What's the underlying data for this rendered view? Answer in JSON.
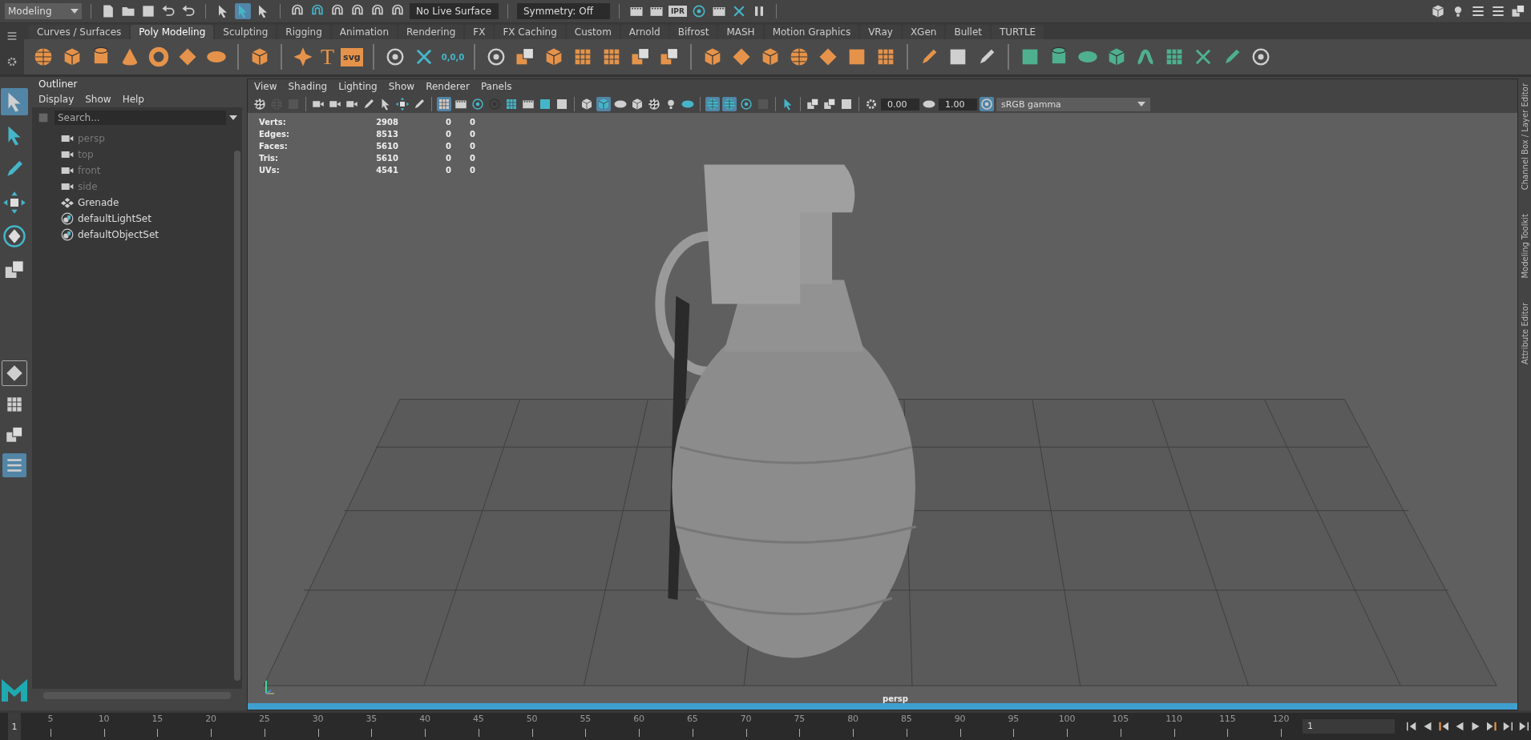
{
  "top_bar": {
    "menu_set": "Modeling",
    "live_surface": "No Live Surface",
    "symmetry": "Symmetry: Off",
    "ipr_label": "IPR"
  },
  "shelf_tabs": [
    {
      "label": "Curves / Surfaces",
      "selected": false
    },
    {
      "label": "Poly Modeling",
      "selected": true
    },
    {
      "label": "Sculpting",
      "selected": false
    },
    {
      "label": "Rigging",
      "selected": false
    },
    {
      "label": "Animation",
      "selected": false
    },
    {
      "label": "Rendering",
      "selected": false
    },
    {
      "label": "FX",
      "selected": false
    },
    {
      "label": "FX Caching",
      "selected": false
    },
    {
      "label": "Custom",
      "selected": false
    },
    {
      "label": "Arnold",
      "selected": false
    },
    {
      "label": "Bifrost",
      "selected": false
    },
    {
      "label": "MASH",
      "selected": false
    },
    {
      "label": "Motion Graphics",
      "selected": false
    },
    {
      "label": "VRay",
      "selected": false
    },
    {
      "label": "XGen",
      "selected": false
    },
    {
      "label": "Bullet",
      "selected": false
    },
    {
      "label": "TURTLE",
      "selected": false
    }
  ],
  "shelf": {
    "type_tool": "T",
    "svg_tool": "svg",
    "freeze_label": "0,0,0"
  },
  "outliner": {
    "tab": "Outliner",
    "menu": [
      "Display",
      "Show",
      "Help"
    ],
    "search_placeholder": "Search...",
    "items": [
      {
        "label": "persp",
        "kind": "camera",
        "dimmed": true
      },
      {
        "label": "top",
        "kind": "camera",
        "dimmed": true
      },
      {
        "label": "front",
        "kind": "camera",
        "dimmed": true
      },
      {
        "label": "side",
        "kind": "camera",
        "dimmed": true
      },
      {
        "label": "Grenade",
        "kind": "group",
        "dimmed": false
      },
      {
        "label": "defaultLightSet",
        "kind": "set",
        "dimmed": false
      },
      {
        "label": "defaultObjectSet",
        "kind": "set",
        "dimmed": false
      }
    ]
  },
  "viewport": {
    "menu": [
      "View",
      "Shading",
      "Lighting",
      "Show",
      "Renderer",
      "Panels"
    ],
    "exposure": "0.00",
    "gamma": "1.00",
    "color_space": "sRGB gamma",
    "hud": [
      {
        "label": "Verts:",
        "values": [
          "2908",
          "0",
          "0"
        ]
      },
      {
        "label": "Edges:",
        "values": [
          "8513",
          "0",
          "0"
        ]
      },
      {
        "label": "Faces:",
        "values": [
          "5610",
          "0",
          "0"
        ]
      },
      {
        "label": "Tris:",
        "values": [
          "5610",
          "0",
          "0"
        ]
      },
      {
        "label": "UVs:",
        "values": [
          "4541",
          "0",
          "0"
        ]
      }
    ],
    "camera": "persp"
  },
  "side_tabs": [
    "Channel Box / Layer Editor",
    "Modeling Toolkit",
    "Attribute Editor"
  ],
  "timeline": {
    "start_frame": "1",
    "ticks": [
      "5",
      "10",
      "15",
      "20",
      "25",
      "30",
      "35",
      "40",
      "45",
      "50",
      "55",
      "60",
      "65",
      "70",
      "75",
      "80",
      "85",
      "90",
      "95",
      "100",
      "105",
      "110",
      "115",
      "120"
    ],
    "current_frame": "1"
  }
}
